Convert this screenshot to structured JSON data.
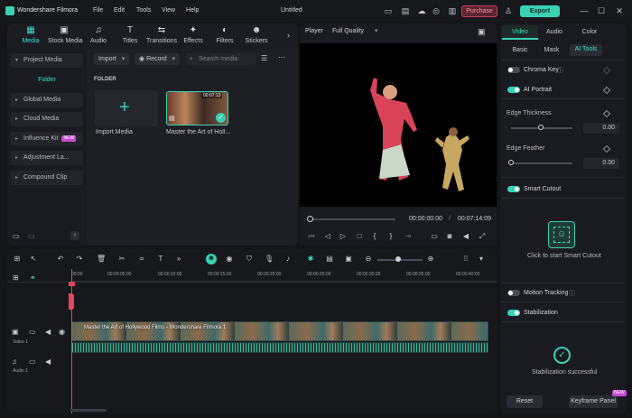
{
  "app": {
    "name": "Wondershare Filmora",
    "menu": [
      "File",
      "Edit",
      "Tools",
      "View",
      "Help"
    ],
    "doc_title": "Untitled",
    "purchase_label": "Purchase",
    "export_label": "Export"
  },
  "media_tools": [
    {
      "label": "Media",
      "icon": "media-icon",
      "glyph": "▦"
    },
    {
      "label": "Stock Media",
      "icon": "stock-media-icon",
      "glyph": "▣"
    },
    {
      "label": "Audio",
      "icon": "music-note-icon",
      "glyph": "♫"
    },
    {
      "label": "Titles",
      "icon": "text-t-icon",
      "glyph": "T"
    },
    {
      "label": "Transitions",
      "icon": "transition-icon",
      "glyph": "⇆"
    },
    {
      "label": "Effects",
      "icon": "sparkle-icon",
      "glyph": "✦"
    },
    {
      "label": "Filters",
      "icon": "filter-icon",
      "glyph": "◐"
    },
    {
      "label": "Stickers",
      "icon": "sticker-icon",
      "glyph": "☻"
    }
  ],
  "left_panel": {
    "project_media": "Project Media",
    "folder": "Folder",
    "global_media": "Global Media",
    "cloud_media": "Cloud Media",
    "influence_kit": "Influence Kit",
    "influence_badge": "NEW",
    "adjustment_layer": "Adjustment La...",
    "compound_clip": "Compound Clip"
  },
  "media_lib": {
    "import_label": "Import",
    "record_label": "Record",
    "search_placeholder": "Search media",
    "folder_heading": "FOLDER",
    "import_card_label": "Import Media",
    "clip_label": "Master the Art of Holl...",
    "clip_duration": "00:07:13"
  },
  "player": {
    "label": "Player",
    "quality": "Full Quality",
    "current_time": "00:00:00:00",
    "total_time": "00:07:14:09",
    "progress": 0
  },
  "right_panel": {
    "tabs": [
      "Video",
      "Audio",
      "Color"
    ],
    "sub_tabs": [
      "Basic",
      "Mask",
      "AI Tools"
    ],
    "chroma_key": "Chroma Key",
    "ai_portrait": "AI Portrait",
    "edge_thickness": "Edge Thickness",
    "edge_thickness_value": "0.00",
    "edge_feather": "Edge Feather",
    "edge_feather_value": "0.00",
    "smart_cutout": "Smart Cutout",
    "smart_cutout_hint": "Click to start Smart Cutout",
    "motion_tracking": "Motion Tracking",
    "stabilization": "Stabilization",
    "stabilization_status": "Stabilization successful",
    "reset": "Reset",
    "keyframe_panel": "Keyframe Panel",
    "keyframe_badge": "NEW"
  },
  "timeline": {
    "ticks": [
      "00:00",
      "00:00:05:00",
      "00:00:10:00",
      "00:00:15:00",
      "00:00:20:00",
      "00:00:25:00",
      "00:00:30:00",
      "00:00:35:00",
      "00:00:40:00"
    ],
    "clip_title": "Master the Art of Hollywood Films - Wondershare Filmora 1",
    "video_track": "Video 1",
    "audio_track": "Audio 1"
  }
}
